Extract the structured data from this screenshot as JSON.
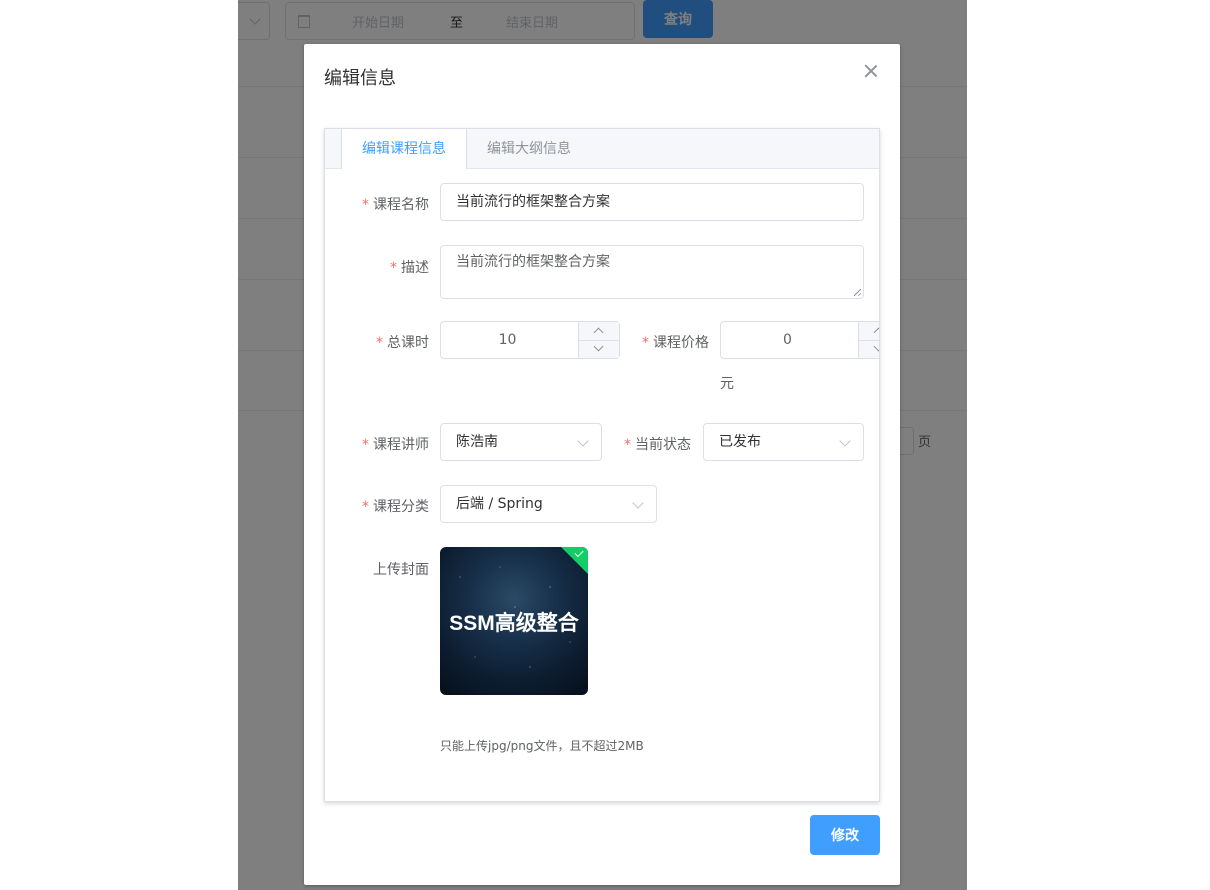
{
  "background": {
    "date_start_placeholder": "开始日期",
    "date_separator": "至",
    "date_end_placeholder": "结束日期",
    "search_button": "查询",
    "pager_suffix": "页"
  },
  "dialog": {
    "title": "编辑信息",
    "tabs": [
      {
        "label": "编辑课程信息",
        "active": true
      },
      {
        "label": "编辑大纲信息",
        "active": false
      }
    ],
    "form": {
      "course_name": {
        "label": "课程名称",
        "value": "当前流行的框架整合方案",
        "required": true
      },
      "description": {
        "label": "描述",
        "value": "当前流行的框架整合方案",
        "required": true
      },
      "total_hours": {
        "label": "总课时",
        "value": "10",
        "required": true
      },
      "price": {
        "label": "课程价格",
        "value": "0",
        "unit": "元",
        "required": true
      },
      "teacher": {
        "label": "课程讲师",
        "value": "陈浩南",
        "required": true
      },
      "status": {
        "label": "当前状态",
        "value": "已发布",
        "required": true
      },
      "category": {
        "label": "课程分类",
        "value": "后端 / Spring",
        "required": true
      },
      "cover": {
        "label": "上传封面",
        "image_text": "SSM高级整合",
        "tip": "只能上传jpg/png文件，且不超过2MB"
      }
    },
    "submit_button": "修改"
  },
  "colors": {
    "primary": "#409eff",
    "required_star": "#f56c6c",
    "success": "#13ce66"
  }
}
